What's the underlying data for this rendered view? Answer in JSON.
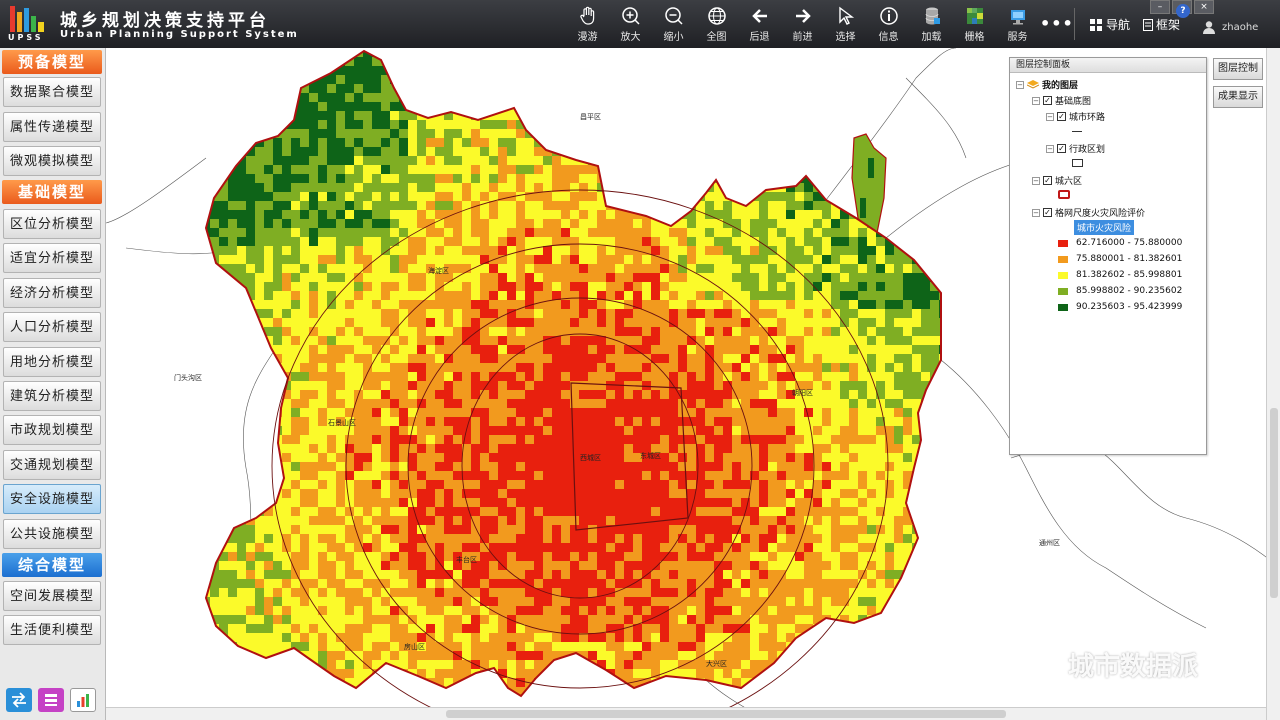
{
  "header": {
    "title": "城乡规划决策支持平台",
    "subtitle": "Urban Planning Support System",
    "logo_text": "UPSS",
    "tools": [
      {
        "label": "漫游",
        "icon": "hand-icon"
      },
      {
        "label": "放大",
        "icon": "zoom-in-icon"
      },
      {
        "label": "缩小",
        "icon": "zoom-out-icon"
      },
      {
        "label": "全图",
        "icon": "globe-icon"
      },
      {
        "label": "后退",
        "icon": "arrow-left-icon"
      },
      {
        "label": "前进",
        "icon": "arrow-right-icon"
      },
      {
        "label": "选择",
        "icon": "cursor-icon"
      },
      {
        "label": "信息",
        "icon": "info-icon"
      },
      {
        "label": "加载",
        "icon": "database-icon"
      },
      {
        "label": "栅格",
        "icon": "raster-icon"
      },
      {
        "label": "服务",
        "icon": "service-icon"
      }
    ],
    "more": "•••",
    "nav_label": "导航",
    "frame_label": "框架",
    "help": "?",
    "user": "zhaohe"
  },
  "left_panel": {
    "categories": [
      {
        "label": "预备模型",
        "items": [
          "数据聚合模型",
          "属性传递模型",
          "微观模拟模型"
        ]
      },
      {
        "label": "基础模型",
        "items": [
          "区位分析模型",
          "适宜分析模型",
          "经济分析模型",
          "人口分析模型",
          "用地分析模型",
          "建筑分析模型",
          "市政规划模型",
          "交通规划模型",
          "安全设施模型",
          "公共设施模型"
        ]
      },
      {
        "label": "综合模型",
        "items": [
          "空间发展模型",
          "生活便利模型"
        ]
      }
    ],
    "active_item": "安全设施模型"
  },
  "map": {
    "places": [
      "昌平区",
      "门头沟区",
      "海淀区",
      "石景山区",
      "朝阳区",
      "西城区",
      "东城区",
      "丰台区",
      "通州区",
      "房山区",
      "大兴区"
    ]
  },
  "layer_panel": {
    "title": "图层控制面板",
    "my_layers": "我的图层",
    "basemap": "基础底图",
    "ring_roads": "城市环路",
    "districts": "行政区划",
    "urban_six": "城六区",
    "grid_layer": "格网尺度火灾风险评价",
    "grid_field": "城市火灾风险",
    "legend": [
      {
        "range": "62.716000 - 75.880000",
        "color": "#e8200e"
      },
      {
        "range": "75.880001 - 81.382601",
        "color": "#f29a1e"
      },
      {
        "range": "81.382602 - 85.998801",
        "color": "#fbfa2a"
      },
      {
        "range": "85.998802 - 90.235602",
        "color": "#7fae23"
      },
      {
        "range": "90.235603 - 95.423999",
        "color": "#0e6418"
      }
    ]
  },
  "side_buttons": {
    "layer_control": "图层控制",
    "result_display": "成果显示"
  },
  "watermark": "城市数据派"
}
